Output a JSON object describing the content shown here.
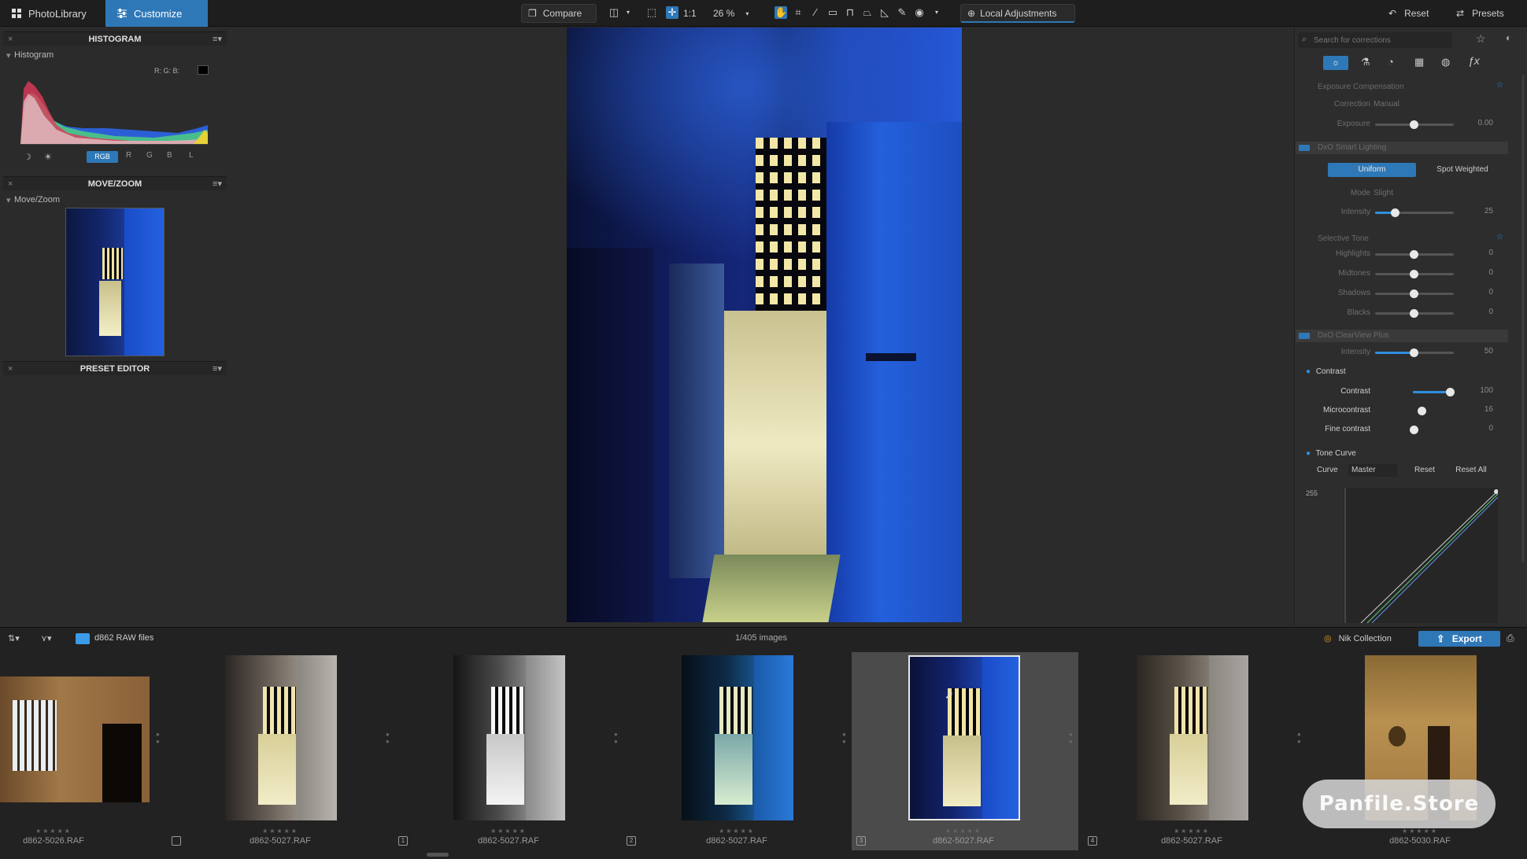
{
  "topbar": {
    "tab_photolibrary": "PhotoLibrary",
    "tab_customize": "Customize",
    "compare_label": "Compare",
    "one_to_one": "1:1",
    "zoom_value": "26 %",
    "local_adjustments": "Local Adjustments",
    "reset_label": "Reset",
    "presets_label": "Presets"
  },
  "left_panel": {
    "histogram_title": "HISTOGRAM",
    "histogram_sub": "Histogram",
    "rgb_readout": "R: G: B:",
    "channels": [
      "RGB",
      "R",
      "G",
      "B",
      "L"
    ],
    "movezoom_title": "MOVE/ZOOM",
    "movezoom_sub": "Move/Zoom",
    "preset_editor_title": "PRESET EDITOR"
  },
  "right_panel": {
    "search_placeholder": "Search for corrections",
    "exposure_comp": "Exposure Compensation",
    "correction_label": "Correction",
    "correction_value": "Manual",
    "exposure_label": "Exposure",
    "exposure_value": "0.00",
    "smart_lighting": "DxO Smart Lighting",
    "uniform": "Uniform",
    "spot_weighted": "Spot Weighted",
    "mode_label": "Mode",
    "mode_value": "Slight",
    "intensity_label": "Intensity",
    "intensity_value": "25",
    "selective_tone": "Selective Tone",
    "highlights_label": "Highlights",
    "highlights_value": "0",
    "midtones_label": "Midtones",
    "midtones_value": "0",
    "shadows_label": "Shadows",
    "shadows_value": "0",
    "blacks_label": "Blacks",
    "blacks_value": "0",
    "clearview": "DxO ClearView Plus",
    "cv_intensity_label": "Intensity",
    "cv_intensity_value": "50",
    "contrast_section": "Contrast",
    "contrast_label": "Contrast",
    "contrast_value": "100",
    "microcontrast_label": "Microcontrast",
    "microcontrast_value": "16",
    "finecontrast_label": "Fine contrast",
    "finecontrast_value": "0",
    "tonecurve_section": "Tone Curve",
    "curve_label": "Curve",
    "curve_value": "Master",
    "curve_reset": "Reset",
    "curve_reset_all": "Reset All",
    "curve_max": "255"
  },
  "filmstrip": {
    "folder": "d862 RAW files",
    "count": "1/405 images",
    "nik_collection": "Nik Collection",
    "export": "Export",
    "files": [
      "d862-5026.RAF",
      "d862-5027.RAF",
      "d862-5027.RAF",
      "d862-5027.RAF",
      "d862-5027.RAF",
      "d862-5027.RAF",
      "d862-5030.RAF"
    ],
    "badges": [
      "",
      "1",
      "2",
      "3",
      "4"
    ]
  },
  "watermark": "Panfile.Store",
  "colors": {
    "accent": "#2f78b7",
    "panel_bg": "#2b2b2b",
    "topbar_bg": "#1e1e1e"
  }
}
